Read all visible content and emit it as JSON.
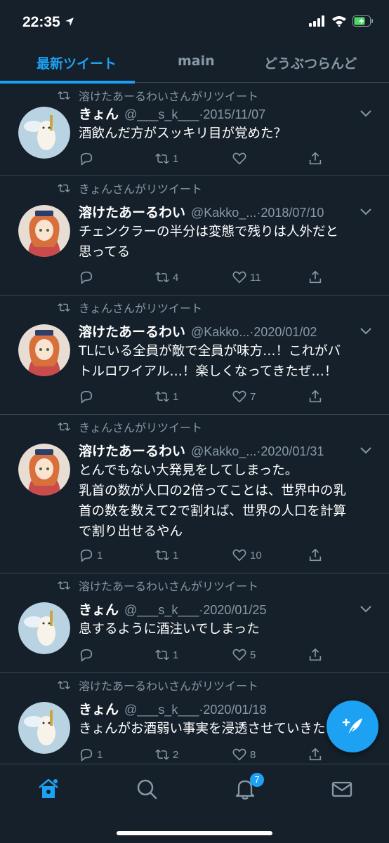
{
  "status": {
    "time": "22:35"
  },
  "tabs": [
    "最新ツイート",
    "main",
    "どうぶつらんど"
  ],
  "tweets": [
    {
      "retweeted_by": "溶けたあーるわいさんがリツイート",
      "name": "きょん",
      "handle": "@___s_k___",
      "date": "·2015/11/07",
      "text": "酒飲んだ方がスッキリ目が覚めた？",
      "replies": "",
      "retweets": "1",
      "likes": "",
      "avatar": "cat"
    },
    {
      "retweeted_by": "きょんさんがリツイート",
      "name": "溶けたあーるわい",
      "handle": "@Kakko_...",
      "date": "·2018/07/10",
      "text": "チェンクラーの半分は変態で残りは人外だと\n思ってる",
      "replies": "",
      "retweets": "4",
      "likes": "11",
      "avatar": "girl"
    },
    {
      "retweeted_by": "きょんさんがリツイート",
      "name": "溶けたあーるわい",
      "handle": "@Kakko...",
      "date": "·2020/01/02",
      "text": "TLにいる全員が敵で全員が味方…！これがバ\nトルロワイアル…！楽しくなってきたぜ…！",
      "replies": "",
      "retweets": "1",
      "likes": "7",
      "avatar": "girl"
    },
    {
      "retweeted_by": "きょんさんがリツイート",
      "name": "溶けたあーるわい",
      "handle": "@Kakko_...",
      "date": "·2020/01/31",
      "text": "とんでもない大発見をしてしまった。\n乳首の数が人口の2倍ってことは、世界中の乳\n首の数を数えて2で割れば、世界の人口を計算\nで割り出せるやん",
      "replies": "1",
      "retweets": "1",
      "likes": "10",
      "avatar": "girl"
    },
    {
      "retweeted_by": "溶けたあーるわいさんがリツイート",
      "name": "きょん",
      "handle": "@___s_k___",
      "date": "·2020/01/25",
      "text": "息するように酒注いでしまった",
      "replies": "",
      "retweets": "1",
      "likes": "5",
      "avatar": "cat"
    },
    {
      "retweeted_by": "溶けたあーるわいさんがリツイート",
      "name": "きょん",
      "handle": "@___s_k___",
      "date": "·2020/01/18",
      "text": "きょんがお酒弱い事実を浸透させていきたい",
      "replies": "1",
      "retweets": "2",
      "likes": "8",
      "avatar": "cat"
    }
  ],
  "bottom_nav": {
    "notifications_badge": "7"
  },
  "icons": [
    "home-icon",
    "search-icon",
    "bell-icon",
    "mail-icon",
    "compose-icon"
  ],
  "colors": {
    "accent": "#1da1f2",
    "background": "#15202b",
    "muted": "#8899a6",
    "divider": "#38444d"
  }
}
